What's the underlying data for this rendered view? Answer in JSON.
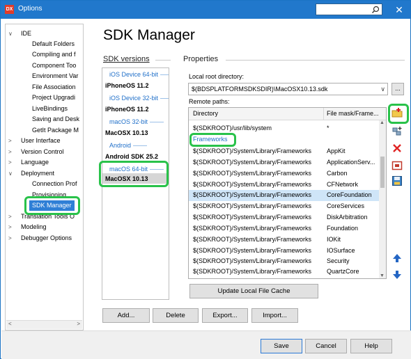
{
  "window": {
    "title": "Options",
    "app_badge": "DX",
    "close_glyph": "✕"
  },
  "sidebar": {
    "items": [
      {
        "label": "IDE",
        "chevron": "∨"
      },
      {
        "label": "Default Folders"
      },
      {
        "label": "Compiling and f"
      },
      {
        "label": "Component Too"
      },
      {
        "label": "Environment Var"
      },
      {
        "label": "File Association"
      },
      {
        "label": "Project Upgradi"
      },
      {
        "label": "LiveBindings"
      },
      {
        "label": "Saving and Desk"
      },
      {
        "label": "GetIt Package M"
      },
      {
        "label": "User Interface",
        "chevron": ">"
      },
      {
        "label": "Version Control",
        "chevron": ">"
      },
      {
        "label": "Language",
        "chevron": ">"
      },
      {
        "label": "Deployment",
        "chevron": "∨"
      },
      {
        "label": "Connection Prof"
      },
      {
        "label": "Provisioning"
      },
      {
        "label": "SDK Manager"
      },
      {
        "label": "Translation Tools O",
        "chevron": ">"
      },
      {
        "label": "Modeling",
        "chevron": ">"
      },
      {
        "label": "Debugger Options",
        "chevron": ">"
      }
    ],
    "scroll_left": "<",
    "scroll_right": ">"
  },
  "page_title": "SDK Manager",
  "sdk_versions": {
    "label": "SDK versions",
    "items": [
      {
        "text": "iOS Device 64-bit",
        "kind": "platform"
      },
      {
        "text": "iPhoneOS 11.2",
        "kind": "sdk"
      },
      {
        "text": "iOS Device 32-bit",
        "kind": "platform"
      },
      {
        "text": "iPhoneOS 11.2",
        "kind": "sdk"
      },
      {
        "text": "macOS 32-bit",
        "kind": "platform"
      },
      {
        "text": "MacOSX 10.13",
        "kind": "sdk"
      },
      {
        "text": "Android",
        "kind": "platform"
      },
      {
        "text": "Android SDK 25.2",
        "kind": "sdk"
      },
      {
        "text": "macOS 64-bit",
        "kind": "platform"
      },
      {
        "text": "MacOSX 10.13",
        "kind": "sdk",
        "selected": true
      }
    ]
  },
  "properties": {
    "label": "Properties",
    "local_root_label": "Local root directory:",
    "local_root_value": "$(BDSPLATFORMSDKSDIR)\\MacOSX10.13.sdk",
    "browse_label": "...",
    "remote_paths_label": "Remote paths:",
    "columns": [
      "Directory",
      "File mask/Frame..."
    ],
    "rows": [
      {
        "dir": "$(SDKROOT)/usr/lib/system",
        "mask": "*"
      },
      {
        "group": "Frameworks"
      },
      {
        "dir": "$(SDKROOT)/System/Library/Frameworks",
        "mask": "AppKit"
      },
      {
        "dir": "$(SDKROOT)/System/Library/Frameworks",
        "mask": "ApplicationServ..."
      },
      {
        "dir": "$(SDKROOT)/System/Library/Frameworks",
        "mask": "Carbon"
      },
      {
        "dir": "$(SDKROOT)/System/Library/Frameworks",
        "mask": "CFNetwork"
      },
      {
        "dir": "$(SDKROOT)/System/Library/Frameworks",
        "mask": "CoreFoundation",
        "selected": true
      },
      {
        "dir": "$(SDKROOT)/System/Library/Frameworks",
        "mask": "CoreServices"
      },
      {
        "dir": "$(SDKROOT)/System/Library/Frameworks",
        "mask": "DiskArbitration"
      },
      {
        "dir": "$(SDKROOT)/System/Library/Frameworks",
        "mask": "Foundation"
      },
      {
        "dir": "$(SDKROOT)/System/Library/Frameworks",
        "mask": "IOKit"
      },
      {
        "dir": "$(SDKROOT)/System/Library/Frameworks",
        "mask": "IOSurface"
      },
      {
        "dir": "$(SDKROOT)/System/Library/Frameworks",
        "mask": "Security"
      },
      {
        "dir": "$(SDKROOT)/System/Library/Frameworks",
        "mask": "QuartzCore"
      }
    ],
    "update_cache_label": "Update Local File Cache"
  },
  "tools": [
    "add-path-icon",
    "add-framework-icon",
    "delete-icon",
    "import-icon",
    "save-icon",
    "move-up-icon",
    "move-down-icon"
  ],
  "buttons": {
    "add": "Add...",
    "delete": "Delete",
    "export": "Export...",
    "import": "Import...",
    "save": "Save",
    "cancel": "Cancel",
    "help": "Help"
  },
  "colors": {
    "titlebar": "#2178cc",
    "selection": "#2f7fd6",
    "highlight": "#29c24a",
    "link_blue": "#1f6fc9"
  }
}
